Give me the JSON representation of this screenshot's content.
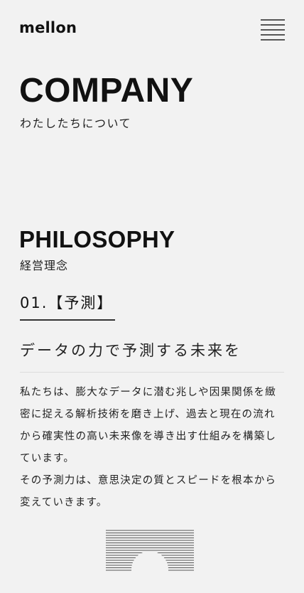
{
  "header": {
    "logo": "mellon",
    "menu_icon": "hamburger-menu-icon"
  },
  "page": {
    "title": "COMPANY",
    "subtitle": "わたしたちについて"
  },
  "philosophy": {
    "title": "PHILOSOPHY",
    "subtitle": "経営理念",
    "item_label": "01.【予測】",
    "headline": "データの力で予測する未来を",
    "paragraphs": [
      "私たちは、膨大なデータに潜む兆しや因果関係を緻密に捉える解析技術を磨き上げ、過去と現在の流れから確実性の高い未来像を導き出す仕組みを構築しています。",
      "その予測力は、意思決定の質とスピードを根本から変えていきます。"
    ],
    "illustration_icon": "striped-arch-illustration"
  },
  "colors": {
    "background": "#f2f2f2",
    "text": "#1b1b1b",
    "divider": "#dcdcdc"
  }
}
